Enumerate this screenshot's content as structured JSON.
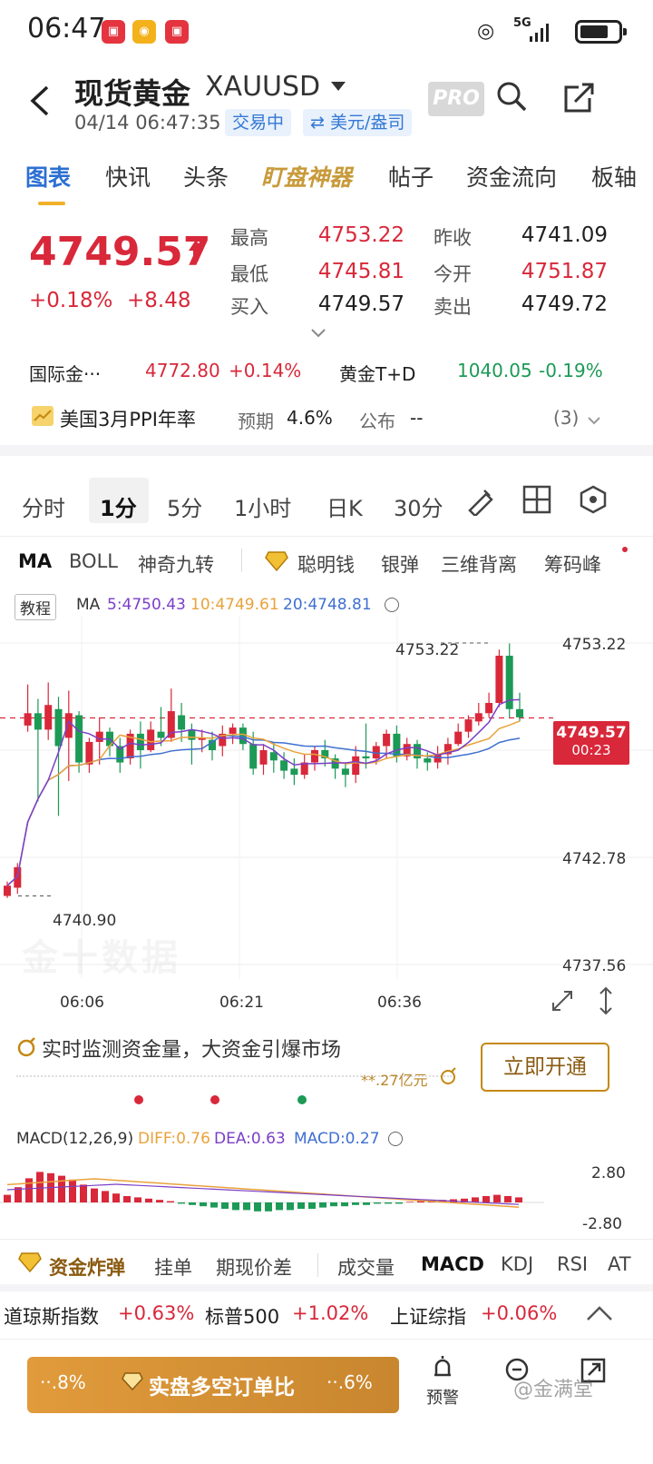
{
  "status": {
    "time": "06:47",
    "network": "5G"
  },
  "header": {
    "title": "现货黄金",
    "symbol": "XAUUSD",
    "datetime": "04/14 06:47:35",
    "trading_status": "交易中",
    "unit": "⇄ 美元/盎司",
    "pro_label": "PRO"
  },
  "tabs": [
    "图表",
    "快讯",
    "头条",
    "盯盘神器",
    "帖子",
    "资金流向",
    "板轴"
  ],
  "quote": {
    "price": "4749.57",
    "change_pct": "+0.18%",
    "change_abs": "+8.48",
    "high_label": "最高",
    "high": "4753.22",
    "low_label": "最低",
    "low": "4745.81",
    "bid_label": "买入",
    "bid": "4749.57",
    "prev_close_label": "昨收",
    "prev_close": "4741.09",
    "open_label": "今开",
    "open": "4751.87",
    "ask_label": "卖出",
    "ask": "4749.72"
  },
  "related": [
    {
      "name": "国际金···",
      "price": "4772.80",
      "change": "+0.14%",
      "color": "#d8283a"
    },
    {
      "name": "黄金T+D",
      "price": "1040.05",
      "change": "-0.19%",
      "color": "#1c9a56"
    }
  ],
  "event": {
    "name": "美国3月PPI年率",
    "forecast_label": "预期",
    "forecast": "4.6%",
    "publish_label": "公布",
    "publish": "--",
    "count": "(3)"
  },
  "periods": [
    "分时",
    "1分",
    "5分",
    "1小时",
    "日K",
    "30分"
  ],
  "active_period": "1分",
  "indicators": [
    "MA",
    "BOLL",
    "神奇九转",
    "聪明钱",
    "银弹",
    "三维背离",
    "筹码峰"
  ],
  "chart": {
    "tutorial_label": "教程",
    "ma_title": "MA",
    "ma5": "5:4750.43",
    "ma10": "10:4749.61",
    "ma20": "20:4748.81",
    "y_top": "4753.22",
    "y_mid": "4742.78",
    "y_bottom": "4737.56",
    "high_marker": "4753.22",
    "low_marker": "4740.90",
    "last_price": "4749.57",
    "countdown": "00:23",
    "x_labels": [
      "06:06",
      "06:21",
      "06:36"
    ],
    "watermark": "金十数据",
    "colors": {
      "up": "#d8283a",
      "down": "#1c9a56",
      "ma5": "#7b3fc7",
      "ma10": "#e9a23b",
      "ma20": "#3f6fd1"
    }
  },
  "fund": {
    "text": "实时监测资金量，大资金引爆市场",
    "amount": "**.27亿元",
    "cta": "立即开通"
  },
  "macd": {
    "title": "MACD(12,26,9)",
    "diff": "DIFF:0.76",
    "dea": "DEA:0.63",
    "macd": "MACD:0.27",
    "y_top": "2.80",
    "y_bottom": "-2.80"
  },
  "bottom_tabs": [
    "资金炸弹",
    "挂单",
    "期现价差",
    "成交量",
    "MACD",
    "KDJ",
    "RSI",
    "AT"
  ],
  "indices": [
    {
      "name": "道琼斯指数",
      "change": "+0.63%"
    },
    {
      "name": "标普500",
      "change": "+1.02%"
    },
    {
      "name": "上证综指",
      "change": "+0.06%"
    }
  ],
  "footer": {
    "left_pct": "··.8%",
    "center_label": "实盘多空订单比",
    "right_pct": "··.6%",
    "alert_label": "预警",
    "watermark": "@金满堂"
  }
}
